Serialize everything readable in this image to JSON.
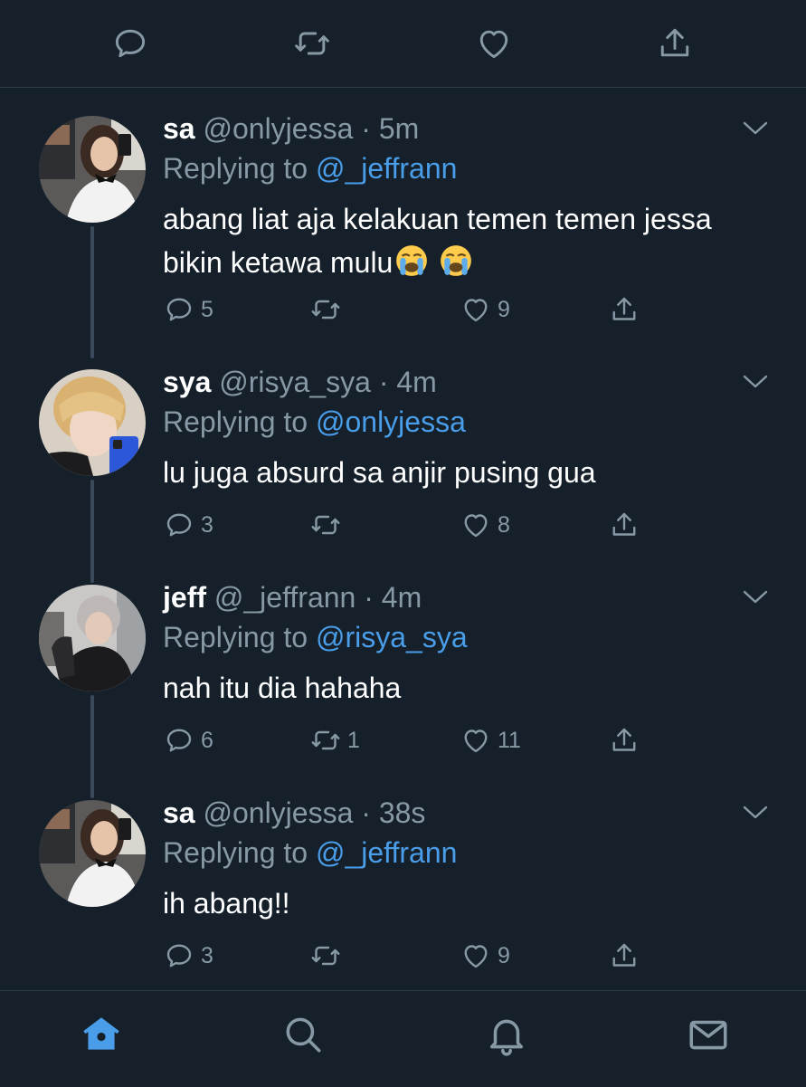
{
  "colors": {
    "background": "#15202b",
    "text": "#ffffff",
    "muted": "#8899a6",
    "link": "#4a9de8",
    "divider": "#2f3d4d",
    "thread_line": "#3a4a5b",
    "active_nav": "#4a9de8"
  },
  "top_actions": [
    "reply-icon",
    "retweet-icon",
    "like-icon",
    "share-icon"
  ],
  "tweets": [
    {
      "name": "sa",
      "handle": "@onlyjessa",
      "dot": "·",
      "time": "5m",
      "replying_prefix": "Replying to ",
      "replying_to": "@_jeffrann",
      "text": "abang liat aja kelakuan temen temen jessa bikin ketawa mulu",
      "emojis": [
        "loudly-crying-face",
        "loudly-crying-face"
      ],
      "replies": "5",
      "retweets": "",
      "likes": "9"
    },
    {
      "name": "sya",
      "handle": "@risya_sya",
      "dot": "·",
      "time": "4m",
      "replying_prefix": "Replying to ",
      "replying_to": "@onlyjessa",
      "text": "lu juga absurd sa anjir pusing gua",
      "replies": "3",
      "retweets": "",
      "likes": "8"
    },
    {
      "name": "jeff",
      "handle": "@_jeffrann",
      "dot": "·",
      "time": "4m",
      "replying_prefix": "Replying to ",
      "replying_to": "@risya_sya",
      "text": "nah itu dia hahaha",
      "replies": "6",
      "retweets": "1",
      "likes": "11"
    },
    {
      "name": "sa",
      "handle": "@onlyjessa",
      "dot": "·",
      "time": "38s",
      "replying_prefix": "Replying to ",
      "replying_to": "@_jeffrann",
      "text": "ih abang!!",
      "replies": "3",
      "retweets": "",
      "likes": "9"
    }
  ],
  "bottom_nav": [
    "home-icon",
    "search-icon",
    "notifications-icon",
    "messages-icon"
  ]
}
